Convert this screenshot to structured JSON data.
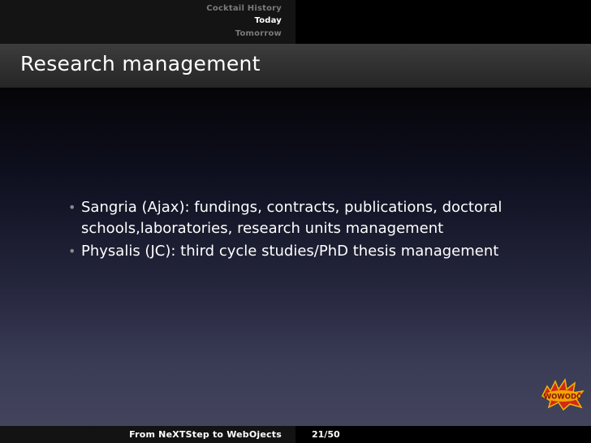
{
  "header": {
    "nav_items": [
      {
        "label": "Cocktail History",
        "active": false
      },
      {
        "label": "Today",
        "active": true
      },
      {
        "label": "Tomorrow",
        "active": false
      }
    ]
  },
  "frame": {
    "title": "Research management"
  },
  "content": {
    "bullets": [
      {
        "text": "Sangria (Ajax): fundings, contracts, publications, doctoral schools,laboratories, research units management"
      },
      {
        "text": "Physalis (JC): third cycle studies/PhD thesis management"
      }
    ],
    "bullet_symbol": "•"
  },
  "logo": {
    "text": "WOWODC",
    "icon": "wowodc-logo-icon"
  },
  "footer": {
    "title": "From NeXTStep to WebOjects",
    "page": "21/50"
  },
  "colors": {
    "nav_inactive": "#7a7a7a",
    "nav_active": "#ffffff",
    "bullet": "#8a8a8a",
    "logo_red": "#d12a1a",
    "logo_yellow": "#f4b400"
  }
}
